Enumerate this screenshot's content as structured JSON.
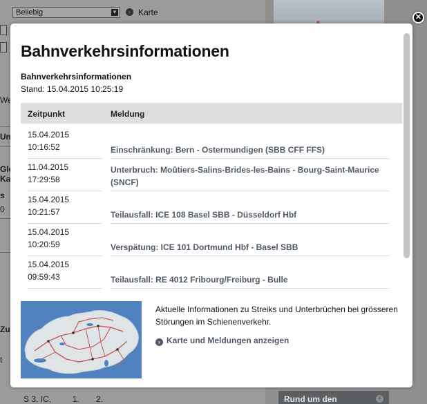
{
  "background": {
    "select_value": "Beliebig",
    "karte_label": "Karte",
    "fragments": [
      "We",
      "Ums",
      "Gleis",
      "Kan",
      "s",
      "0",
      "Zus",
      "t",
      "S 3, IC,",
      "1.",
      "2."
    ],
    "action_button_label": "Rund um den"
  },
  "modal": {
    "title": "Bahnverkehrsinformationen",
    "subtitle": "Bahnverkehrsinformationen",
    "stand": "Stand: 15.04.2015 10:25:19",
    "columns": {
      "time": "Zeitpunkt",
      "message": "Meldung"
    },
    "rows": [
      {
        "date": "15.04.2015",
        "time": "10:16:52",
        "message": "Einschränkung: Bern - Ostermundigen (SBB CFF FFS)"
      },
      {
        "date": "11.04.2015",
        "time": "17:29:58",
        "message": "Unterbruch: Moûtiers-Salins-Brides-les-Bains - Bourg-Saint-Maurice (SNCF)"
      },
      {
        "date": "15.04.2015",
        "time": "10:21:57",
        "message": "Teilausfall: ICE 108 Basel SBB - Düsseldorf Hbf"
      },
      {
        "date": "15.04.2015",
        "time": "10:20:59",
        "message": "Verspätung: ICE 101 Dortmund Hbf - Basel SBB"
      },
      {
        "date": "15.04.2015",
        "time": "09:59:43",
        "message": "Teilausfall: RE 4012 Fribourg/Freiburg - Bulle"
      }
    ],
    "info_text": "Aktuelle Informationen zu Streiks und Unterbrüchen bei grösseren Störungen im Schienenverkehr.",
    "info_link": "Karte und Meldungen anzeigen",
    "close_icon": "close-icon",
    "link_icon": "chevron-circle-right-icon"
  },
  "colors": {
    "overlay": "#9a9a9a",
    "header_bg": "#dedede",
    "link": "#505a66",
    "map_water": "#4f82bf"
  }
}
